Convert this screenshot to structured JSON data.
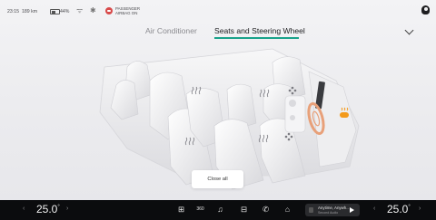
{
  "status": {
    "time": "23:15",
    "range": "189 km",
    "battery": "44%",
    "airbag_line1": "PASSENGER",
    "airbag_line2": "AIRBAG ON"
  },
  "tabs": [
    {
      "label": "Air Conditioner",
      "active": false
    },
    {
      "label": "Seats and Steering Wheel",
      "active": true
    }
  ],
  "colors": {
    "accent": "#19a28a",
    "heat": "#f39a1b",
    "airbag": "#d84a4a"
  },
  "close_all_label": "Close all",
  "dock": {
    "left_temp": "25.0",
    "right_temp": "25.0",
    "temp_unit": "°",
    "media": {
      "title": "Anytime, Anywh..",
      "subtitle": "Second Audio"
    },
    "icons": [
      "apps-icon",
      "360-camera-icon",
      "music-icon",
      "car-icon",
      "phone-icon",
      "home-icon"
    ],
    "camera_label": "360"
  }
}
